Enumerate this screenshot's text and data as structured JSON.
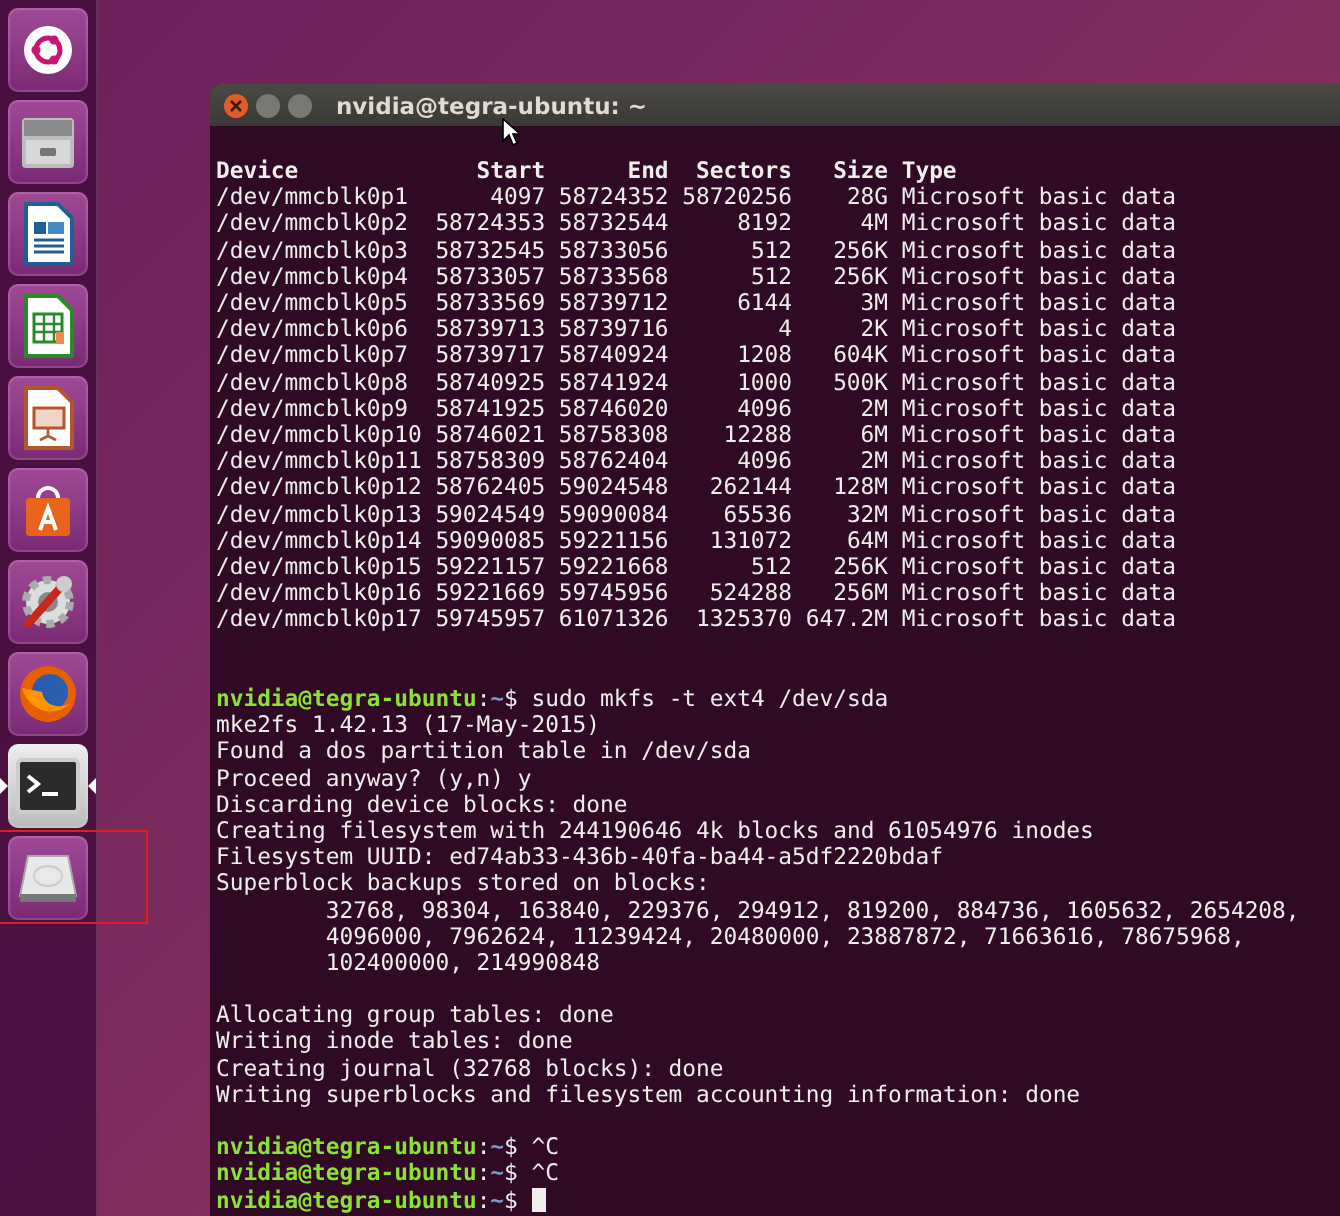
{
  "launcher": {
    "items": [
      {
        "kind": "ubuntu",
        "active": false
      },
      {
        "kind": "files",
        "active": false
      },
      {
        "kind": "writer",
        "active": false
      },
      {
        "kind": "calc",
        "active": false
      },
      {
        "kind": "impress",
        "active": false
      },
      {
        "kind": "store",
        "active": false
      },
      {
        "kind": "settings",
        "active": false
      },
      {
        "kind": "firefox",
        "active": false
      },
      {
        "kind": "terminal",
        "active": true
      },
      {
        "kind": "drive",
        "active": false,
        "highlighted": true
      }
    ]
  },
  "window": {
    "title": "nvidia@tegra-ubuntu: ~"
  },
  "table": {
    "columns": [
      "Device",
      "Start",
      "End",
      "Sectors",
      "Size",
      "Type"
    ],
    "rows": [
      [
        "/dev/mmcblk0p1",
        "4097",
        "58724352",
        "58720256",
        "28G",
        "Microsoft basic data"
      ],
      [
        "/dev/mmcblk0p2",
        "58724353",
        "58732544",
        "8192",
        "4M",
        "Microsoft basic data"
      ],
      [
        "/dev/mmcblk0p3",
        "58732545",
        "58733056",
        "512",
        "256K",
        "Microsoft basic data"
      ],
      [
        "/dev/mmcblk0p4",
        "58733057",
        "58733568",
        "512",
        "256K",
        "Microsoft basic data"
      ],
      [
        "/dev/mmcblk0p5",
        "58733569",
        "58739712",
        "6144",
        "3M",
        "Microsoft basic data"
      ],
      [
        "/dev/mmcblk0p6",
        "58739713",
        "58739716",
        "4",
        "2K",
        "Microsoft basic data"
      ],
      [
        "/dev/mmcblk0p7",
        "58739717",
        "58740924",
        "1208",
        "604K",
        "Microsoft basic data"
      ],
      [
        "/dev/mmcblk0p8",
        "58740925",
        "58741924",
        "1000",
        "500K",
        "Microsoft basic data"
      ],
      [
        "/dev/mmcblk0p9",
        "58741925",
        "58746020",
        "4096",
        "2M",
        "Microsoft basic data"
      ],
      [
        "/dev/mmcblk0p10",
        "58746021",
        "58758308",
        "12288",
        "6M",
        "Microsoft basic data"
      ],
      [
        "/dev/mmcblk0p11",
        "58758309",
        "58762404",
        "4096",
        "2M",
        "Microsoft basic data"
      ],
      [
        "/dev/mmcblk0p12",
        "58762405",
        "59024548",
        "262144",
        "128M",
        "Microsoft basic data"
      ],
      [
        "/dev/mmcblk0p13",
        "59024549",
        "59090084",
        "65536",
        "32M",
        "Microsoft basic data"
      ],
      [
        "/dev/mmcblk0p14",
        "59090085",
        "59221156",
        "131072",
        "64M",
        "Microsoft basic data"
      ],
      [
        "/dev/mmcblk0p15",
        "59221157",
        "59221668",
        "512",
        "256K",
        "Microsoft basic data"
      ],
      [
        "/dev/mmcblk0p16",
        "59221669",
        "59745956",
        "524288",
        "256M",
        "Microsoft basic data"
      ],
      [
        "/dev/mmcblk0p17",
        "59745957",
        "61071326",
        "1325370",
        "647.2M",
        "Microsoft basic data"
      ]
    ]
  },
  "output": [
    {
      "kind": "blank"
    },
    {
      "kind": "blank"
    },
    {
      "kind": "prompt",
      "user_host": "nvidia@tegra-ubuntu",
      "separator": ":",
      "path": "~",
      "symbol": "$",
      "command": "sudo mkfs -t ext4 /dev/sda"
    },
    {
      "kind": "text",
      "text": "mke2fs 1.42.13 (17-May-2015)"
    },
    {
      "kind": "text",
      "text": "Found a dos partition table in /dev/sda"
    },
    {
      "kind": "text",
      "text": "Proceed anyway? (y,n) y"
    },
    {
      "kind": "text",
      "text": "Discarding device blocks: done"
    },
    {
      "kind": "text",
      "text": "Creating filesystem with 244190646 4k blocks and 61054976 inodes"
    },
    {
      "kind": "text",
      "text": "Filesystem UUID: ed74ab33-436b-40fa-ba44-a5df2220bdaf"
    },
    {
      "kind": "text",
      "text": "Superblock backups stored on blocks:"
    },
    {
      "kind": "indented",
      "text": "32768, 98304, 163840, 229376, 294912, 819200, 884736, 1605632, 2654208,"
    },
    {
      "kind": "indented",
      "text": "4096000, 7962624, 11239424, 20480000, 23887872, 71663616, 78675968,"
    },
    {
      "kind": "indented",
      "text": "102400000, 214990848"
    },
    {
      "kind": "blank"
    },
    {
      "kind": "text",
      "text": "Allocating group tables: done"
    },
    {
      "kind": "text",
      "text": "Writing inode tables: done"
    },
    {
      "kind": "text",
      "text": "Creating journal (32768 blocks): done"
    },
    {
      "kind": "text",
      "text": "Writing superblocks and filesystem accounting information: done"
    },
    {
      "kind": "blank"
    },
    {
      "kind": "prompt",
      "user_host": "nvidia@tegra-ubuntu",
      "separator": ":",
      "path": "~",
      "symbol": "$",
      "command": "^C"
    },
    {
      "kind": "prompt",
      "user_host": "nvidia@tegra-ubuntu",
      "separator": ":",
      "path": "~",
      "symbol": "$",
      "command": "^C"
    },
    {
      "kind": "prompt",
      "user_host": "nvidia@tegra-ubuntu",
      "separator": ":",
      "path": "~",
      "symbol": "$",
      "cursor": true
    }
  ]
}
